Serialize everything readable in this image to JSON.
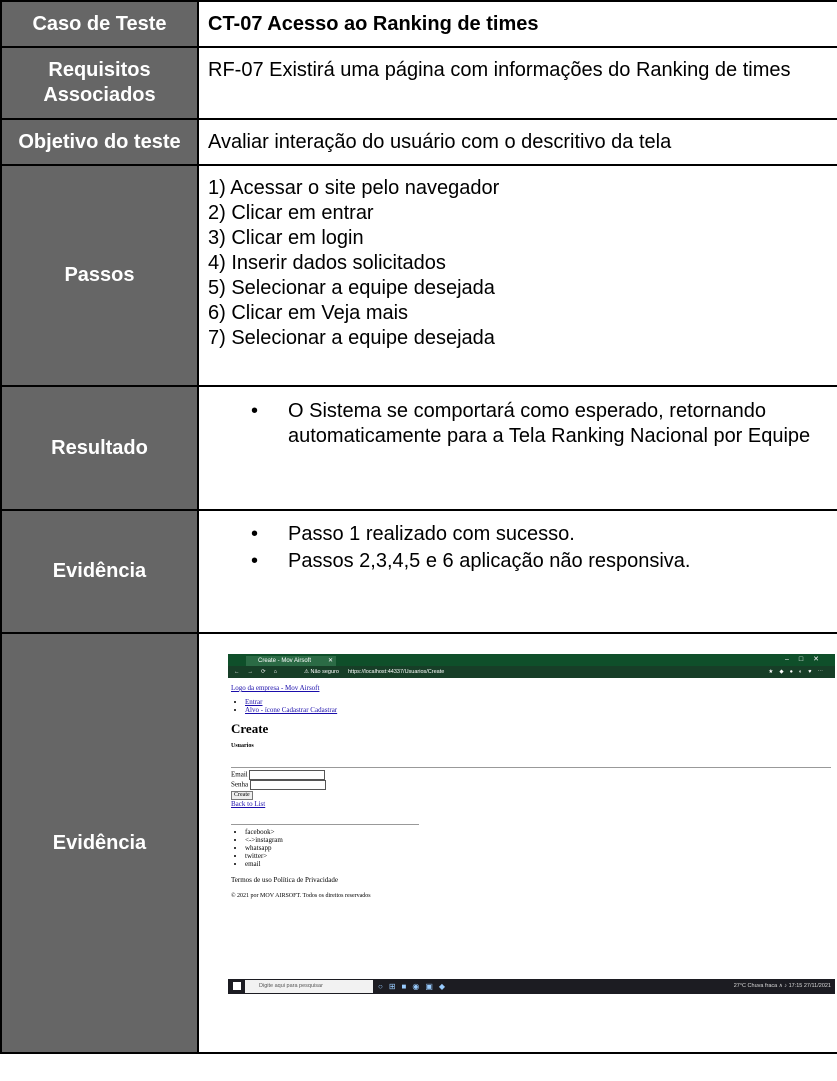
{
  "rows": {
    "case": {
      "label": "Caso de Teste",
      "value": "CT-07 Acesso ao Ranking de times"
    },
    "req": {
      "label": "Requisitos Associados",
      "value": "RF-07 Existirá uma página com informações do Ranking de times"
    },
    "obj": {
      "label": "Objetivo do teste",
      "value": "Avaliar interação do usuário com o descritivo da tela"
    },
    "steps": {
      "label": "Passos",
      "items": [
        "1) Acessar o site pelo navegador",
        "2) Clicar em entrar",
        "3) Clicar em login",
        "4) Inserir dados solicitados",
        "5) Selecionar a equipe desejada",
        "6) Clicar em Veja mais",
        "7) Selecionar a equipe desejada"
      ]
    },
    "result": {
      "label": "Resultado",
      "items": [
        "O Sistema se comportará como esperado, retornando",
        "automaticamente para a Tela Ranking Nacional por Equipe"
      ]
    },
    "evidence1": {
      "label": "Evidência",
      "items": [
        "Passo 1 realizado com sucesso.",
        "Passos 2,3,4,5 e 6 aplicação não responsiva."
      ]
    },
    "evidence2": {
      "label": "Evidência"
    }
  },
  "screenshot": {
    "tab_title": "Create - Mov Airsoft",
    "not_secure": "Não seguro",
    "url": "https://localhost:44337/Usuarios/Create",
    "logo_alt": "Logo da empresa - Mov Airsoft",
    "nav": [
      "Entrar",
      "Alvo - ícone Cadastrar Cadastrar"
    ],
    "heading": "Create",
    "subheading": "Usuarios",
    "email_label": "Email",
    "password_label": "Senha",
    "create_button": "Create",
    "back_link": "Back to List",
    "social": [
      "facebook>",
      "<->instagram",
      "whatsapp",
      "twitter>",
      "email"
    ],
    "terms": "Termos de uso Política de Privacidade",
    "copyright": "© 2021 por MOV AIRSOFT. Todos os direitos reservados",
    "taskbar_search": "Digite aqui para pesquisar",
    "weather": "27°C Chuva fraca",
    "clock_time": "17:15",
    "clock_date": "27/11/2021"
  }
}
